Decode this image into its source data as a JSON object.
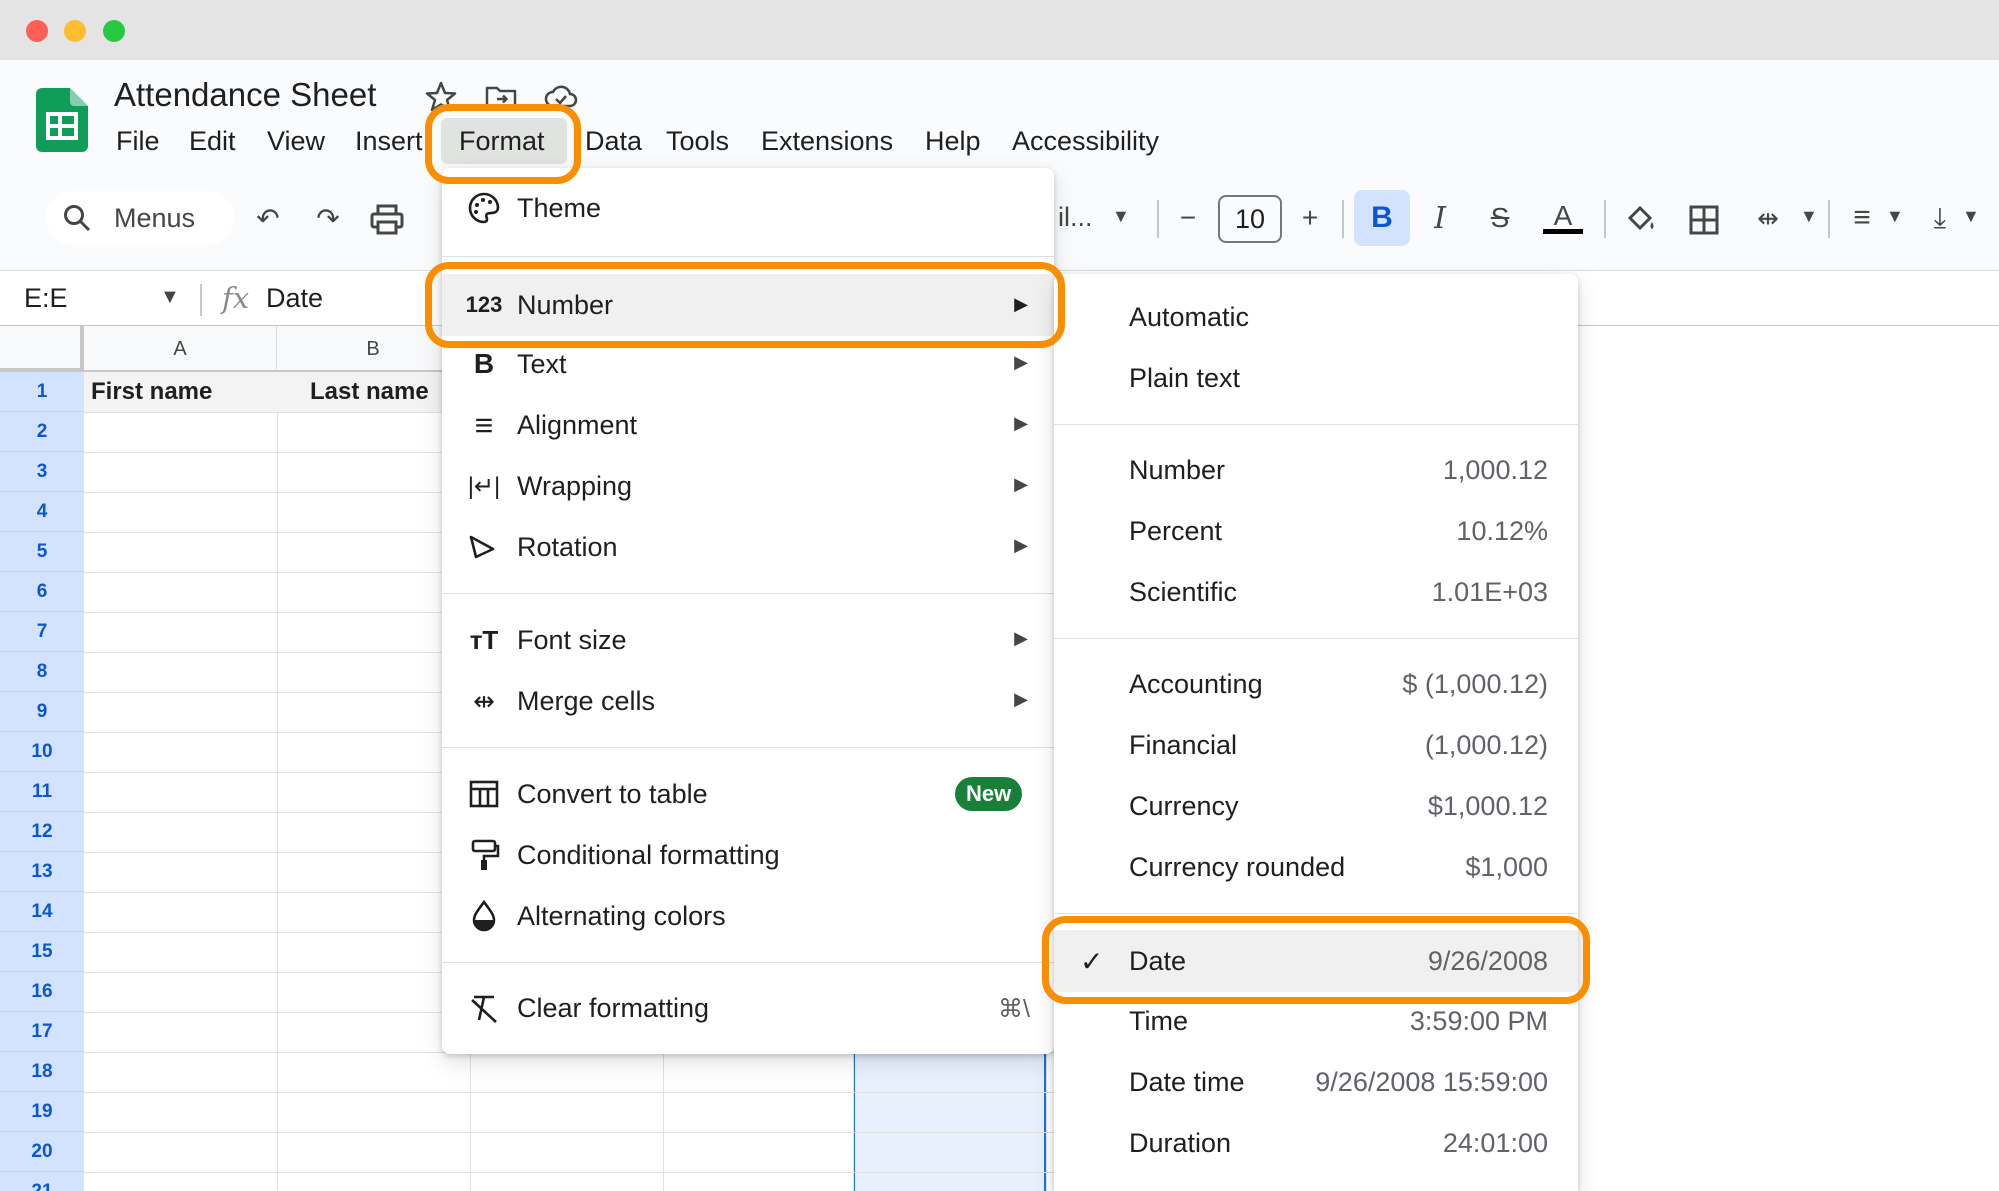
{
  "window": {
    "title": "Attendance Sheet"
  },
  "menubar": [
    "File",
    "Edit",
    "View",
    "Insert",
    "Format",
    "Data",
    "Tools",
    "Extensions",
    "Help",
    "Accessibility"
  ],
  "toolbar": {
    "search_label": "Menus",
    "font_name_truncated": "il...",
    "font_size": "10",
    "bold": "B",
    "italic": "I",
    "text_color_glyph": "A"
  },
  "formula_bar": {
    "name_box": "E:E",
    "fx": "fx",
    "value": "Date"
  },
  "sheet": {
    "columns": [
      "A",
      "B"
    ],
    "header_row": [
      "First name",
      "Last name"
    ],
    "row_numbers": [
      "1",
      "2",
      "3",
      "4",
      "5",
      "6",
      "7",
      "8",
      "9",
      "10",
      "11",
      "12",
      "13",
      "14",
      "15",
      "16",
      "17",
      "18",
      "19",
      "20",
      "21"
    ]
  },
  "format_menu": {
    "items": [
      {
        "label": "Theme",
        "icon": "palette-icon"
      },
      {
        "label": "Number",
        "icon": "123-icon"
      },
      {
        "label": "Text",
        "icon": "bold-icon"
      },
      {
        "label": "Alignment",
        "icon": "align-icon"
      },
      {
        "label": "Wrapping",
        "icon": "wrap-icon"
      },
      {
        "label": "Rotation",
        "icon": "rotation-icon"
      },
      {
        "label": "Font size",
        "icon": "font-size-icon"
      },
      {
        "label": "Merge cells",
        "icon": "merge-icon"
      },
      {
        "label": "Convert to table",
        "icon": "table-icon",
        "badge": "New"
      },
      {
        "label": "Conditional formatting",
        "icon": "paint-roller-icon"
      },
      {
        "label": "Alternating colors",
        "icon": "drop-icon"
      },
      {
        "label": "Clear formatting",
        "icon": "clear-format-icon",
        "shortcut": "⌘\\"
      }
    ]
  },
  "number_submenu": {
    "items": [
      {
        "label": "Automatic",
        "value": ""
      },
      {
        "label": "Plain text",
        "value": ""
      },
      {
        "label": "Number",
        "value": "1,000.12"
      },
      {
        "label": "Percent",
        "value": "10.12%"
      },
      {
        "label": "Scientific",
        "value": "1.01E+03"
      },
      {
        "label": "Accounting",
        "value": "$ (1,000.12)"
      },
      {
        "label": "Financial",
        "value": "(1,000.12)"
      },
      {
        "label": "Currency",
        "value": "$1,000.12"
      },
      {
        "label": "Currency rounded",
        "value": "$1,000"
      },
      {
        "label": "Date",
        "value": "9/26/2008",
        "checked": true
      },
      {
        "label": "Time",
        "value": "3:59:00 PM"
      },
      {
        "label": "Date time",
        "value": "9/26/2008 15:59:00"
      },
      {
        "label": "Duration",
        "value": "24:01:00"
      }
    ]
  },
  "colors": {
    "highlight": "#f98e00",
    "accent": "#0b57d0",
    "new_badge": "#188038",
    "sheets_green": "#0f9d58"
  }
}
